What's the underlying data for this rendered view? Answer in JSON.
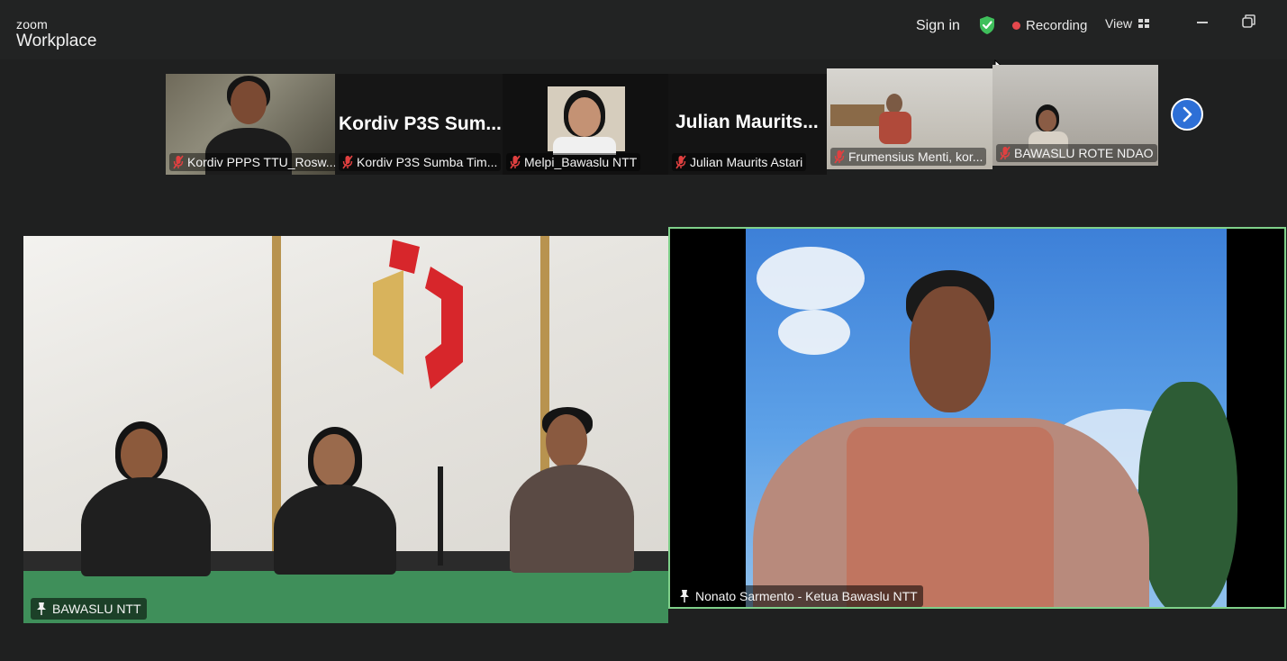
{
  "app": {
    "brand_small": "zoom",
    "brand_big": "Workplace"
  },
  "header": {
    "sign_in": "Sign in",
    "recording": "Recording",
    "view": "View",
    "icons": [
      "shield-check-icon",
      "recording-dot-icon",
      "grid-view-icon",
      "minimize-icon",
      "restore-icon"
    ],
    "colors": {
      "shield": "#3fbf5b",
      "recording_dot": "#e5484d"
    }
  },
  "thumbnails": [
    {
      "label": "Kordiv PPPS TTU_Rosw...",
      "muted": true
    },
    {
      "label": "Kordiv P3S Sumba Tim...",
      "name_display": "Kordiv P3S Sum...",
      "muted": true
    },
    {
      "label": "Melpi_Bawaslu NTT",
      "muted": true
    },
    {
      "label": "Julian Maurits Astari",
      "name_display": "Julian Maurits...",
      "muted": true
    },
    {
      "label": "Frumensius Menti, kor...",
      "muted": true
    },
    {
      "label": "BAWASLU ROTE NDAO",
      "muted": true
    }
  ],
  "main_tiles": {
    "left": {
      "label": "BAWASLU NTT"
    },
    "right": {
      "label": "Nonato Sarmento - Ketua Bawaslu NTT",
      "active_speaker_color": "#7fd08a"
    }
  },
  "next_button_icon": "chevron-right-icon"
}
